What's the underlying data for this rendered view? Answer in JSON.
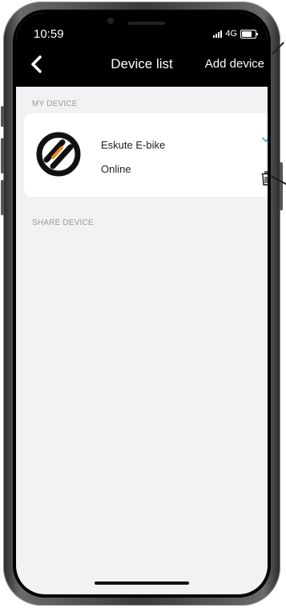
{
  "status_bar": {
    "time": "10:59",
    "network": "4G"
  },
  "nav": {
    "title": "Device list",
    "action": "Add device"
  },
  "my_device": {
    "section_label": "MY DEVICE",
    "devices": [
      {
        "name": "Eskute E-bike",
        "status": "Online",
        "selected": true
      }
    ]
  },
  "share_device": {
    "section_label": "SHARE DEVICE"
  },
  "icons": {
    "back": "chevron-left-icon",
    "selected": "checkmark-icon",
    "delete": "trash-icon",
    "logo": "eskute-logo"
  },
  "colors": {
    "nav_background": "#000000",
    "screen_background": "#f2f2f4",
    "check_accent": "#4aa3df",
    "logo_orange": "#f08a2c"
  }
}
